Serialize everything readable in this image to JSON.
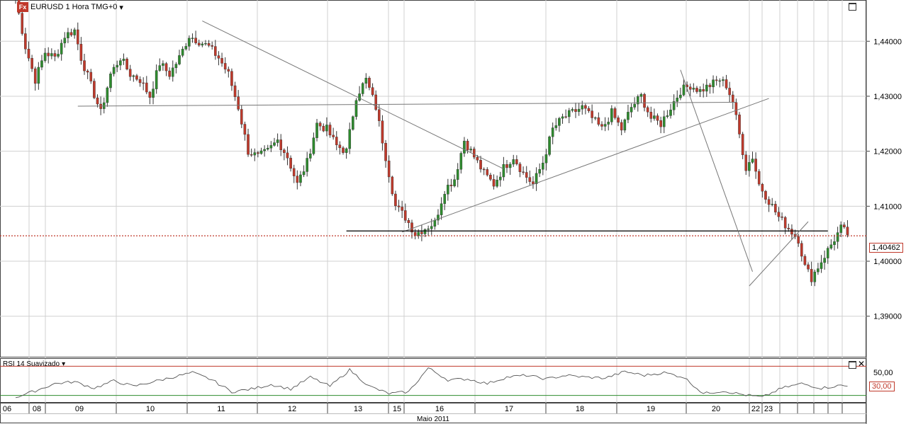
{
  "header": {
    "logo_text": "Fx",
    "symbol_title": "EURUSD 1 Hora TMG+0",
    "dropdown_arrow": "▾"
  },
  "rsi_panel": {
    "title": "RSI 14 Suavizado",
    "level_50_label": "50,00",
    "level_30_label": "30,00"
  },
  "current_price_label": "1,40462",
  "x_axis": {
    "month_label": "Maio 2011",
    "day_labels": [
      "06",
      "08",
      "09",
      "10",
      "11",
      "12",
      "13",
      "15",
      "16",
      "17",
      "18",
      "19",
      "20",
      "22",
      "23"
    ]
  },
  "colors": {
    "bull": "#2e8b2e",
    "bear": "#c0392b",
    "wick": "#333333",
    "trendline": "#777777",
    "support": "#111111",
    "current_price_line": "#c0392b",
    "rsi_line": "#555555",
    "rsi_upper_band": "#c0392b",
    "rsi_lower_band": "#2e8b2e",
    "grid": "#d0d0d0"
  },
  "icons": [
    "maximize-icon",
    "close-icon"
  ],
  "chart_data": {
    "type": "candlestick",
    "title": "EURUSD 1 Hora TMG+0",
    "ylim": [
      1.3825,
      1.4475
    ],
    "y_ticks": [
      "1,39000",
      "1,40000",
      "1,41000",
      "1,42000",
      "1,43000",
      "1,44000"
    ],
    "y_tick_values": [
      1.39,
      1.4,
      1.41,
      1.42,
      1.43,
      1.44
    ],
    "current_price": 1.40462,
    "close_anchors": [
      [
        0,
        1.448
      ],
      [
        3,
        1.439
      ],
      [
        6,
        1.433
      ],
      [
        9,
        1.438
      ],
      [
        12,
        1.437
      ],
      [
        15,
        1.441
      ],
      [
        18,
        1.442
      ],
      [
        20,
        1.437
      ],
      [
        23,
        1.432
      ],
      [
        26,
        1.427
      ],
      [
        29,
        1.434
      ],
      [
        32,
        1.437
      ],
      [
        35,
        1.434
      ],
      [
        38,
        1.433
      ],
      [
        41,
        1.43
      ],
      [
        44,
        1.436
      ],
      [
        47,
        1.434
      ],
      [
        50,
        1.437
      ],
      [
        53,
        1.441
      ],
      [
        56,
        1.44
      ],
      [
        59,
        1.439
      ],
      [
        62,
        1.437
      ],
      [
        65,
        1.434
      ],
      [
        68,
        1.428
      ],
      [
        71,
        1.42
      ],
      [
        74,
        1.419
      ],
      [
        77,
        1.42
      ],
      [
        80,
        1.422
      ],
      [
        83,
        1.419
      ],
      [
        86,
        1.414
      ],
      [
        89,
        1.418
      ],
      [
        92,
        1.425
      ],
      [
        95,
        1.424
      ],
      [
        98,
        1.421
      ],
      [
        101,
        1.42
      ],
      [
        104,
        1.43
      ],
      [
        107,
        1.433
      ],
      [
        110,
        1.428
      ],
      [
        113,
        1.419
      ],
      [
        116,
        1.41
      ],
      [
        119,
        1.408
      ],
      [
        122,
        1.405
      ],
      [
        125,
        1.406
      ],
      [
        128,
        1.407
      ],
      [
        131,
        1.413
      ],
      [
        134,
        1.415
      ],
      [
        137,
        1.422
      ],
      [
        140,
        1.419
      ],
      [
        143,
        1.416
      ],
      [
        146,
        1.414
      ],
      [
        149,
        1.417
      ],
      [
        152,
        1.419
      ],
      [
        155,
        1.416
      ],
      [
        158,
        1.414
      ],
      [
        161,
        1.418
      ],
      [
        164,
        1.424
      ],
      [
        167,
        1.426
      ],
      [
        170,
        1.427
      ],
      [
        173,
        1.428
      ],
      [
        176,
        1.426
      ],
      [
        179,
        1.424
      ],
      [
        182,
        1.427
      ],
      [
        185,
        1.424
      ],
      [
        188,
        1.428
      ],
      [
        191,
        1.43
      ],
      [
        194,
        1.426
      ],
      [
        197,
        1.425
      ],
      [
        200,
        1.428
      ],
      [
        203,
        1.431
      ],
      [
        206,
        1.432
      ],
      [
        209,
        1.431
      ],
      [
        212,
        1.432
      ],
      [
        215,
        1.433
      ],
      [
        217,
        1.432
      ],
      [
        219,
        1.429
      ],
      [
        221,
        1.423
      ],
      [
        223,
        1.417
      ],
      [
        225,
        1.419
      ],
      [
        227,
        1.414
      ],
      [
        230,
        1.411
      ],
      [
        233,
        1.408
      ],
      [
        236,
        1.406
      ],
      [
        239,
        1.404
      ],
      [
        241,
        1.399
      ],
      [
        243,
        1.397
      ],
      [
        245,
        1.399
      ],
      [
        247,
        1.401
      ],
      [
        250,
        1.404
      ],
      [
        252,
        1.406
      ],
      [
        254,
        1.405
      ]
    ],
    "trendlines": [
      {
        "name": "descending-resistance",
        "points": [
          [
            57,
            1.4437
          ],
          [
            149,
            1.4168
          ]
        ]
      },
      {
        "name": "horizontal-neckline",
        "points": [
          [
            19,
            1.4282
          ],
          [
            220,
            1.4289
          ]
        ]
      },
      {
        "name": "ascending-support",
        "points": [
          [
            118,
            1.4053
          ],
          [
            230,
            1.4296
          ]
        ]
      },
      {
        "name": "support-1.4055",
        "points": [
          [
            101,
            1.4055
          ],
          [
            248,
            1.4055
          ]
        ]
      },
      {
        "name": "steep-downtrend",
        "points": [
          [
            203,
            1.4348
          ],
          [
            225,
            1.3981
          ]
        ]
      },
      {
        "name": "short-uptrend",
        "points": [
          [
            224,
            1.3955
          ],
          [
            242,
            1.4072
          ]
        ]
      }
    ],
    "rsi": {
      "name": "RSI 14 Suavizado",
      "ylim": [
        22,
        70
      ],
      "upper_band": 62,
      "mid_level": 50,
      "lower_band": 30,
      "anchors": [
        [
          0,
          28
        ],
        [
          6,
          35
        ],
        [
          12,
          43
        ],
        [
          18,
          45
        ],
        [
          24,
          38
        ],
        [
          30,
          46
        ],
        [
          36,
          40
        ],
        [
          42,
          45
        ],
        [
          48,
          50
        ],
        [
          54,
          55
        ],
        [
          60,
          47
        ],
        [
          66,
          34
        ],
        [
          72,
          37
        ],
        [
          78,
          42
        ],
        [
          84,
          37
        ],
        [
          90,
          50
        ],
        [
          96,
          40
        ],
        [
          102,
          58
        ],
        [
          108,
          40
        ],
        [
          114,
          32
        ],
        [
          120,
          34
        ],
        [
          126,
          60
        ],
        [
          132,
          47
        ],
        [
          138,
          48
        ],
        [
          144,
          43
        ],
        [
          150,
          50
        ],
        [
          156,
          52
        ],
        [
          162,
          48
        ],
        [
          168,
          52
        ],
        [
          174,
          50
        ],
        [
          180,
          49
        ],
        [
          186,
          56
        ],
        [
          192,
          52
        ],
        [
          198,
          55
        ],
        [
          204,
          50
        ],
        [
          210,
          32
        ],
        [
          216,
          35
        ],
        [
          222,
          31
        ],
        [
          228,
          28
        ],
        [
          234,
          38
        ],
        [
          240,
          43
        ],
        [
          246,
          38
        ],
        [
          252,
          41
        ],
        [
          254,
          40
        ]
      ]
    }
  }
}
